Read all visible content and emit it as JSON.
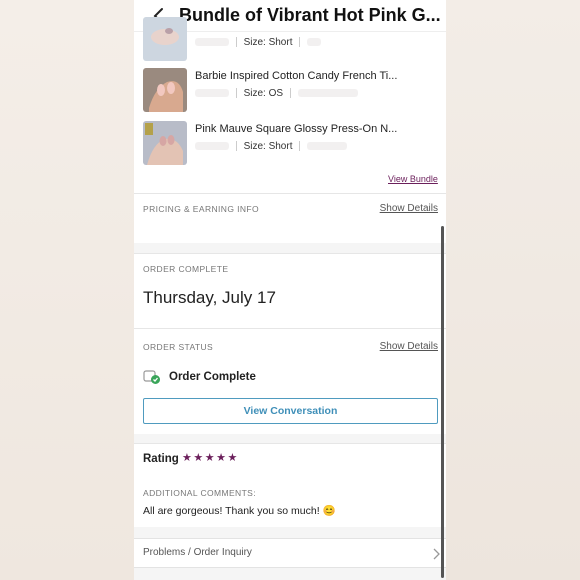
{
  "header": {
    "title": "Bundle of Vibrant Hot Pink G..."
  },
  "items": [
    {
      "title": "",
      "size": "Size: Short"
    },
    {
      "title": "Barbie Inspired Cotton Candy French Ti...",
      "size": "Size: OS"
    },
    {
      "title": "Pink Mauve Square Glossy Press-On N...",
      "size": "Size: Short"
    }
  ],
  "bundle": {
    "view_bundle": "View Bundle"
  },
  "pricing": {
    "label": "PRICING & EARNING INFO",
    "show_details": "Show Details"
  },
  "order_complete": {
    "label": "ORDER COMPLETE",
    "date": "Thursday, July 17"
  },
  "order_status": {
    "label": "ORDER STATUS",
    "show_details": "Show Details",
    "status": "Order Complete"
  },
  "conversation": {
    "button": "View Conversation"
  },
  "rating": {
    "label": "Rating",
    "stars": "★★★★★",
    "value": 5
  },
  "comments": {
    "label": "ADDITIONAL COMMENTS:",
    "text": "All are gorgeous! Thank you so much! 😊"
  },
  "problems": {
    "label": "Problems / Order Inquiry"
  },
  "colors": {
    "accent": "#6b1f5b",
    "link": "#3f8fb8"
  }
}
